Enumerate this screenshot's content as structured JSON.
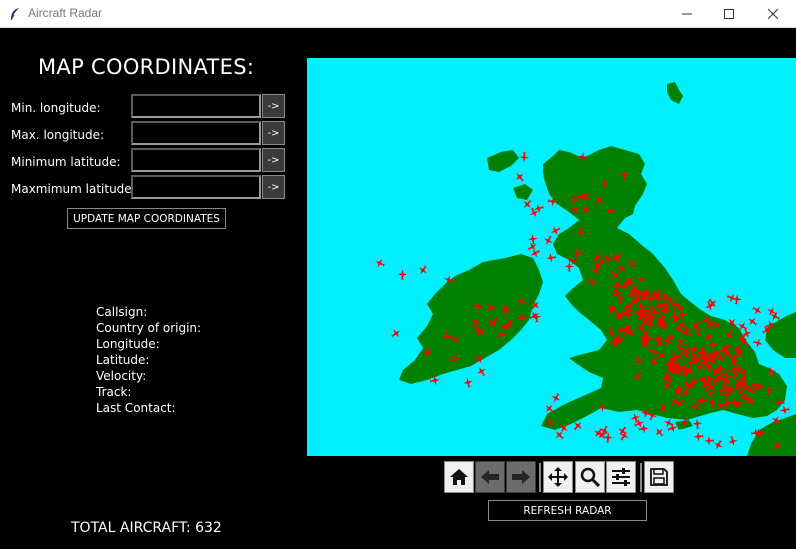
{
  "window": {
    "title": "Aircraft Radar"
  },
  "coordinates": {
    "heading": "MAP COORDINATES:",
    "fields": [
      {
        "label": "Min. longitude:",
        "value": "",
        "button": "->"
      },
      {
        "label": "Max. longitude:",
        "value": "",
        "button": "->"
      },
      {
        "label": "Minimum latitude:",
        "value": "",
        "button": "->"
      },
      {
        "label": "Maxmimum latitude:",
        "value": "",
        "button": "->"
      }
    ],
    "update_label": "UPDATE MAP COORDINATES"
  },
  "info": {
    "callsign": "Callsign:",
    "country": "Country of origin:",
    "longitude": "Longitude:",
    "latitude": "Latitude:",
    "velocity": "Velocity:",
    "track": "Track:",
    "last_contact": "Last Contact:"
  },
  "total_label": "TOTAL AIRCRAFT: 632",
  "refresh_label": "REFRESH RADAR",
  "toolbar": [
    "home-icon",
    "back-arrow-icon",
    "forward-arrow-icon",
    "pan-icon",
    "zoom-icon",
    "configure-subplots-icon",
    "save-icon"
  ],
  "colors": {
    "sea": "#00f0ff",
    "land": "#008000",
    "aircraft": "#ff0000",
    "background": "#000000"
  }
}
